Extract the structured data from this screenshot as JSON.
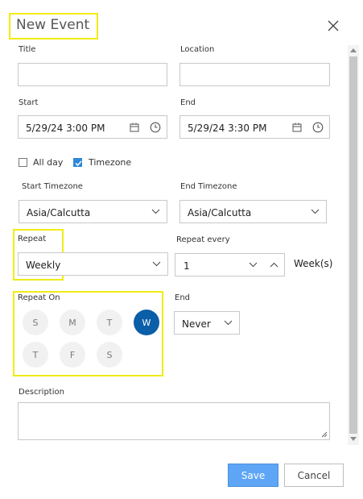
{
  "dialog": {
    "title": "New Event",
    "close_icon": "close-icon"
  },
  "fields": {
    "title_label": "Title",
    "title_value": "",
    "location_label": "Location",
    "location_value": "",
    "start_label": "Start",
    "start_value": "5/29/24 3:00 PM",
    "end_label": "End",
    "end_value": "5/29/24 3:30 PM",
    "calendar_icon": "calendar-icon",
    "clock_icon": "clock-icon"
  },
  "checkboxes": {
    "allday_label": "All day",
    "allday_checked": false,
    "timezone_label": "Timezone",
    "timezone_checked": true
  },
  "timezones": {
    "start_label": "Start Timezone",
    "start_value": "Asia/Calcutta",
    "end_label": "End Timezone",
    "end_value": "Asia/Calcutta"
  },
  "repeat": {
    "label": "Repeat",
    "value": "Weekly",
    "every_label": "Repeat every",
    "every_value": "1",
    "every_unit": "Week(s)"
  },
  "repeat_on": {
    "label": "Repeat On",
    "days": [
      {
        "label": "S",
        "selected": false
      },
      {
        "label": "M",
        "selected": false
      },
      {
        "label": "T",
        "selected": false
      },
      {
        "label": "W",
        "selected": true
      },
      {
        "label": "T",
        "selected": false
      },
      {
        "label": "F",
        "selected": false
      },
      {
        "label": "S",
        "selected": false
      }
    ]
  },
  "end": {
    "label": "End",
    "value": "Never"
  },
  "description": {
    "label": "Description",
    "value": ""
  },
  "buttons": {
    "save": "Save",
    "cancel": "Cancel"
  },
  "colors": {
    "highlight": "#f0ec16",
    "selected_day": "#0b5ea8",
    "save_button": "#5ea6f5"
  }
}
